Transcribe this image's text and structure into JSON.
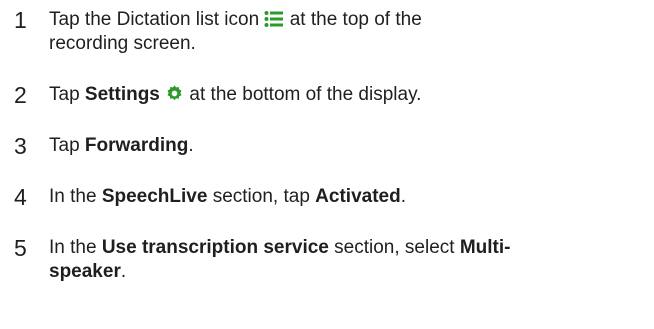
{
  "steps": [
    {
      "number": "1",
      "pre": "Tap the Dictation list icon ",
      "icon": "dictation-list-icon",
      "post_line1": " at the top of the",
      "post_line2": "recording screen."
    },
    {
      "number": "2",
      "pre": "Tap ",
      "bold": "Settings",
      "icon": "settings-gear-icon",
      "post": " at the bottom of the display."
    },
    {
      "number": "3",
      "pre": "Tap ",
      "bold": "Forwarding",
      "post": "."
    },
    {
      "number": "4",
      "pre": "In the ",
      "bold1": "SpeechLive",
      "mid": " section, tap ",
      "bold2": "Activated",
      "post": "."
    },
    {
      "number": "5",
      "pre": "In the ",
      "bold1": "Use transcription service",
      "mid": " section, select ",
      "bold2_line1": "Multi-",
      "bold2_line2": "speaker",
      "post": "."
    }
  ],
  "colors": {
    "text": "#1f1f1f",
    "icon_accent": "#2a9a2a"
  }
}
